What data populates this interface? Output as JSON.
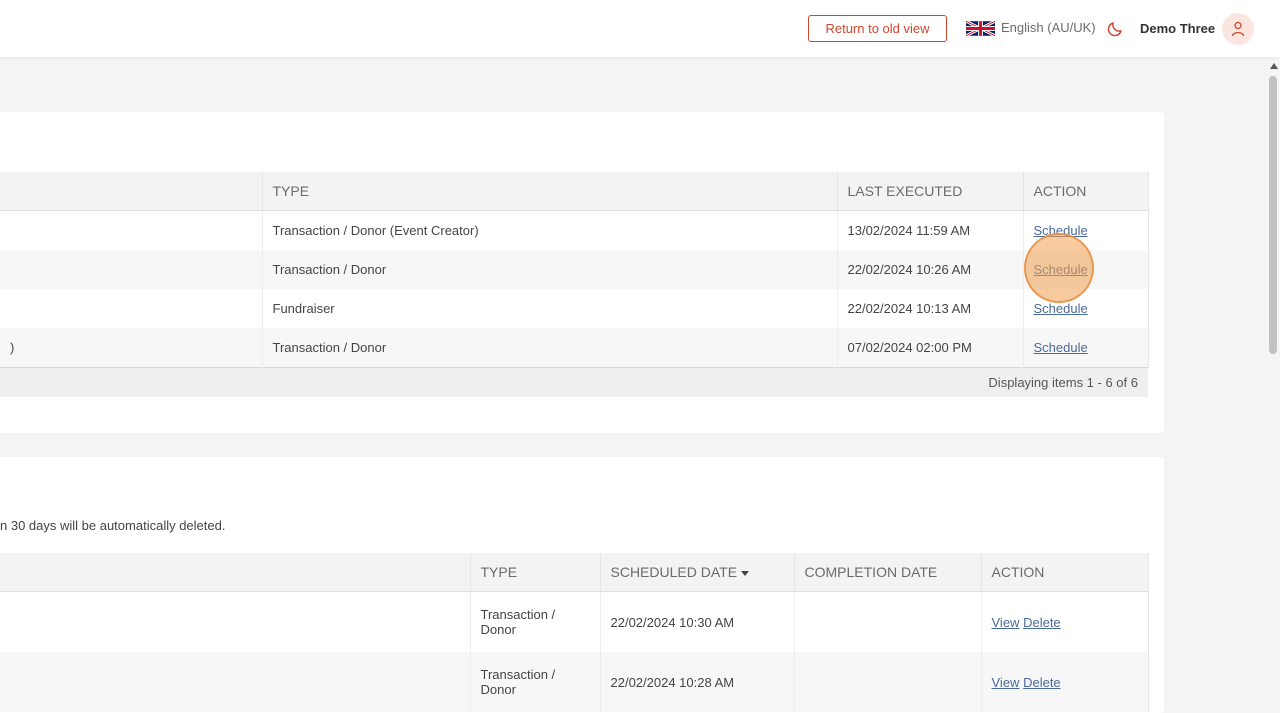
{
  "header": {
    "old_view_label": "Return to old view",
    "language": "English (AU/UK)",
    "user_name": "Demo Three",
    "accent_color": "#d0462e"
  },
  "reports": {
    "columns": [
      "",
      "TYPE",
      "LAST EXECUTED",
      "ACTION"
    ],
    "rows": [
      {
        "name": "",
        "type": "Transaction / Donor (Event Creator)",
        "last_executed": "13/02/2024 11:59 AM",
        "action": "Schedule"
      },
      {
        "name": "",
        "type": "Transaction / Donor",
        "last_executed": "22/02/2024 10:26 AM",
        "action": "Schedule"
      },
      {
        "name": "",
        "type": "Fundraiser",
        "last_executed": "22/02/2024 10:13 AM",
        "action": "Schedule"
      },
      {
        "name": ")",
        "type": "Transaction / Donor",
        "last_executed": "07/02/2024 02:00 PM",
        "action": "Schedule"
      }
    ],
    "footer": "Displaying items 1 - 6 of 6"
  },
  "scheduled": {
    "note": "n 30 days will be automatically deleted.",
    "columns": [
      "",
      "TYPE",
      "SCHEDULED DATE",
      "COMPLETION DATE",
      "ACTION"
    ],
    "rows": [
      {
        "name": "",
        "type": "Transaction / Donor",
        "scheduled_date": "22/02/2024 10:30 AM",
        "completion_date": "",
        "view": "View",
        "delete": "Delete"
      },
      {
        "name": "",
        "type": "Transaction / Donor",
        "scheduled_date": "22/02/2024 10:28 AM",
        "completion_date": "",
        "view": "View",
        "delete": "Delete"
      }
    ]
  }
}
